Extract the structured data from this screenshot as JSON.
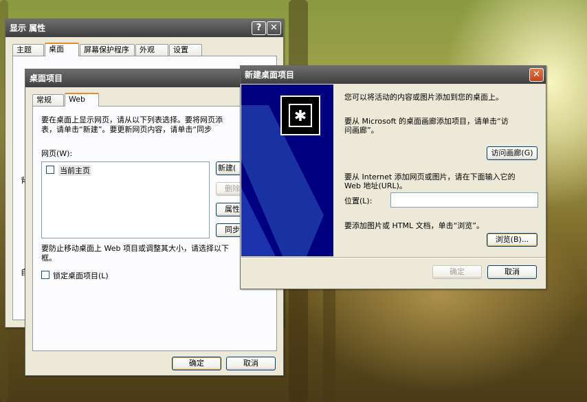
{
  "display_props": {
    "title": "显示 属性",
    "tabs": [
      "主题",
      "桌面",
      "屏幕保护程序",
      "外观",
      "设置"
    ],
    "help_btn": "?",
    "close_btn": "✕",
    "partial_label": "背",
    "cut_label": "自"
  },
  "desktop_items": {
    "title": "桌面项目",
    "tabs": [
      "常规",
      "Web"
    ],
    "intro_line1": "要在桌面上显示网页，请从以下列表选择。要将网页添",
    "intro_line2": "表，请单击“新建”。要更新网页内容，请单击“同步",
    "webpages_label": "网页(W):",
    "list_items": [
      {
        "label": "当前主页",
        "checked": false
      }
    ],
    "buttons": {
      "new": "新建(",
      "delete": "删除",
      "props": "属性",
      "sync": "同步"
    },
    "lock_hint_line1": "要防止移动桌面上 Web 项目或调整其大小，请选择以下",
    "lock_hint_line2": "框。",
    "lock_label": "锁定桌面项目(L)",
    "ok": "确定",
    "cancel": "取消"
  },
  "new_item": {
    "title": "新建桌面项目",
    "close_btn": "✕",
    "line_intro": "您可以将活动的内容或图片添加到您的桌面上。",
    "gallery_line1": "要从 Microsoft 的桌面画廊添加项目，请单击“访",
    "gallery_line2": "问画廊”。",
    "gallery_btn": "访问画廊(G)",
    "internet_line1": "要从 Internet 添加网页或图片，请在下面输入它的",
    "internet_line2": "Web 地址(URL)。",
    "location_label": "位置(L):",
    "location_value": "",
    "html_line": "要添加图片或 HTML 文档，单击“浏览”。",
    "browse_btn": "浏览(B)...",
    "ok": "确定",
    "cancel": "取消"
  },
  "colors": {
    "accent_tab": "#e68b2c",
    "wizard_blue": "#000080",
    "button_border": "#003c74"
  }
}
